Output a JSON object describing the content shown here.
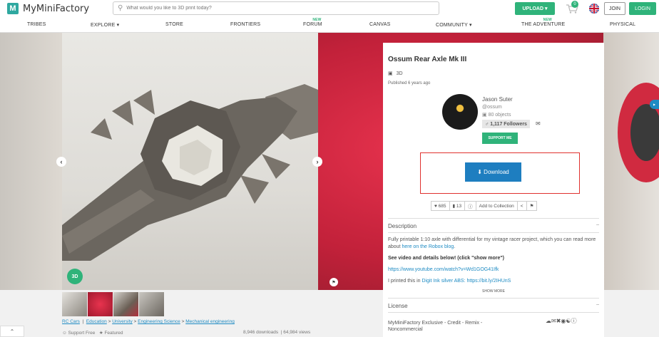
{
  "header": {
    "logo_text": "MyMiniFactory",
    "search_placeholder": "What would you like to 3D print today?",
    "upload_label": "UPLOAD ▾",
    "cart_count": "0",
    "join_label": "JOIN",
    "login_label": "LOGIN"
  },
  "nav": {
    "items": [
      "TRIBES",
      "EXPLORE ▾",
      "STORE",
      "FRONTIERS",
      "FORUM",
      "CANVAS",
      "COMMUNITY ▾",
      "THE ADVENTURE",
      "PHYSICAL"
    ],
    "new_label": "NEW"
  },
  "gallery": {
    "badge_3d": "3D",
    "prev_icon": "chevron-left-icon",
    "next_icon": "chevron-right-icon"
  },
  "object": {
    "title": "Ossum Rear Axle Mk III",
    "tag_3d": "3D",
    "published": "Published 6 years ago"
  },
  "creator": {
    "name": "Jason Suter",
    "handle": "@ossum",
    "objects": "80 objects",
    "followers": "1,117 Followers",
    "support_label": "SUPPORT ME"
  },
  "download_label": "Download",
  "actions": {
    "likes": "685",
    "comments": "13",
    "add_to_collection": "Add to Collection"
  },
  "description": {
    "heading": "Description",
    "text1": "Fully printable 1:10 axle with differential for my vintage racer project, which you can read more about ",
    "link1": "here on the Robox blog",
    "text1_end": ".",
    "bold": "See video and details below! (click \"show more\")",
    "video_link": "https://www.youtube.com/watch?v=Wd1GOG41Ifk",
    "text2_start": "I printed this in ",
    "link2": "Digit Ink silver ABS: https://bit.ly/2IHUnS",
    "show_more": "SHOW MORE"
  },
  "license": {
    "heading": "License",
    "text": "MyMiniFactory Exclusive - Credit - Remix - Noncommercial"
  },
  "bottom": {
    "breadcrumb": [
      "RC Cars",
      "Education",
      "University",
      "Engineering Science",
      "Mechanical engineering"
    ],
    "support_free": "Support Free",
    "featured": "Featured",
    "downloads": "8,946 downloads",
    "views": "64,984 views"
  },
  "colors": {
    "accent_green": "#2fb37a",
    "download_blue": "#1e7ec0",
    "highlight_red": "#e0312f"
  }
}
